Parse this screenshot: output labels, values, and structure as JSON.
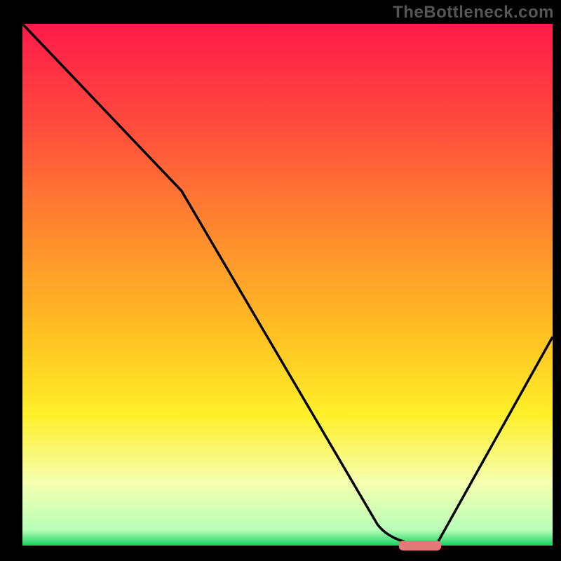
{
  "watermark": "TheBottleneck.com",
  "chart_data": {
    "type": "line",
    "title": "",
    "xlabel": "",
    "ylabel": "",
    "xlim": [
      0,
      100
    ],
    "ylim": [
      0,
      100
    ],
    "x": [
      0,
      10,
      20,
      30,
      40,
      50,
      60,
      68,
      72,
      78,
      100
    ],
    "values": [
      100,
      90,
      80,
      68,
      55,
      42,
      28,
      10,
      0,
      0,
      40
    ],
    "curve_segments": [
      {
        "kind": "line",
        "from_x": 0,
        "from_y": 100,
        "to_x": 30,
        "to_y": 68
      },
      {
        "kind": "line",
        "from_x": 30,
        "from_y": 68,
        "to_x": 67,
        "to_y": 4
      },
      {
        "kind": "curve",
        "from_x": 67,
        "from_y": 4,
        "to_x": 78,
        "to_y": 0,
        "ctrl_x": 70,
        "ctrl_y": 0
      },
      {
        "kind": "line",
        "from_x": 78,
        "from_y": 0,
        "to_x": 100,
        "to_y": 40
      }
    ],
    "marker": {
      "x_start": 71,
      "x_end": 79,
      "y": 0,
      "color": "#e07a7a"
    },
    "gradient_stops": [
      {
        "offset": 0.0,
        "color": "#ff1a4a"
      },
      {
        "offset": 0.2,
        "color": "#ff4d3d"
      },
      {
        "offset": 0.4,
        "color": "#ff8a2e"
      },
      {
        "offset": 0.6,
        "color": "#ffc222"
      },
      {
        "offset": 0.75,
        "color": "#fff02a"
      },
      {
        "offset": 0.88,
        "color": "#f5ffb0"
      },
      {
        "offset": 0.97,
        "color": "#b8ffb8"
      },
      {
        "offset": 1.0,
        "color": "#15d060"
      }
    ],
    "background_outside_plot": "#000000"
  }
}
